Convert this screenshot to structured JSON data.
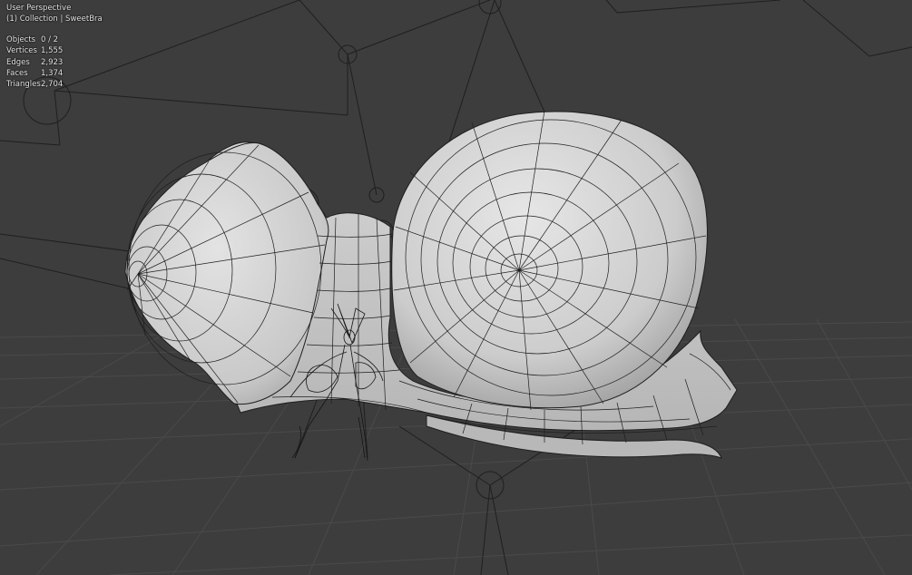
{
  "viewport": {
    "view_label": "User Perspective",
    "collection_label": "(1) Collection | SweetBra",
    "background_color": "#3d3d3d",
    "grid_color": "#4a4a4a",
    "mesh_fill_color": "#cfcfcf",
    "wire_color": "#1e1e1e"
  },
  "stats": [
    {
      "label": "Objects",
      "value": "0 / 2"
    },
    {
      "label": "Vertices",
      "value": "1,555"
    },
    {
      "label": "Edges",
      "value": "2,923"
    },
    {
      "label": "Faces",
      "value": "1,374"
    },
    {
      "label": "Triangles",
      "value": "2,704"
    }
  ]
}
